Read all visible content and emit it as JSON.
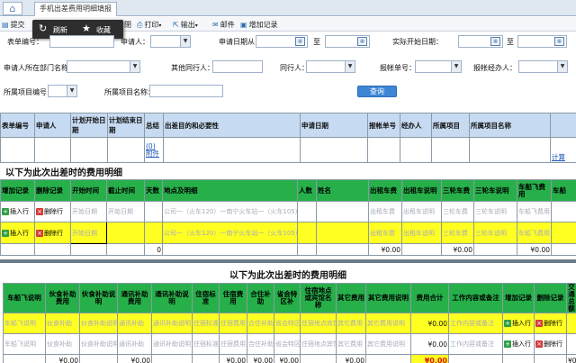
{
  "tab_title": "手机出差费用明细填报",
  "toolbar": {
    "submit": "提交",
    "print": "打印",
    "export": "输出",
    "mail": "邮件",
    "add_record": "增加记录",
    "frag": "閉"
  },
  "popup": {
    "refresh": "刷新",
    "favorite": "收藏"
  },
  "form": {
    "form_no": "表单编号：",
    "applicant": "申请人：",
    "apply_date_from": "申请日期从",
    "to1": "至",
    "actual_start": "实际开始日期：",
    "to2": "至",
    "dept": "申请人所在部门名称：",
    "other_companion": "其他同行人：",
    "companion": "同行人：",
    "reimb_no": "报帐单号：",
    "reimb_handler": "报帐经办人：",
    "project_no": "所属项目编号：",
    "project_name": "所属项目名称：",
    "query": "查询"
  },
  "grid1": {
    "headers": [
      "表单编号",
      "申请人",
      "计划开始日期",
      "计划结束日期",
      "总结",
      "出差目的和必要性",
      "申请日期",
      "报帐单号",
      "经办人",
      "所属项目",
      "所属项目名称"
    ],
    "summary_link": "(0)附件",
    "settle_link": "计算"
  },
  "section1_title": "以下为此次出差时的费用明细",
  "grid2": {
    "headers": [
      "增加记录",
      "删除记录",
      "开始时间",
      "截止时间",
      "天数",
      "地点及明细",
      "人数",
      "姓名",
      "出租车费",
      "出租车说明",
      "三轮车费",
      "三轮车说明",
      "车船飞费用",
      "车船"
    ],
    "insert_label": "插入行",
    "delete_label": "删除行",
    "start_placeholder": "开始日期",
    "end_placeholder": "开始日期",
    "route_placeholder": "公司一（火车120）一南宁火车站一（火车105）人数",
    "taxi_placeholder": "出租车费",
    "taxi_note_placeholder": "出租车说明",
    "tricycle_placeholder": "三轮车费",
    "tricycle_note_placeholder": "三轮车说明",
    "vehicle_placeholder": "车船飞费用",
    "zero_days": "0",
    "sum_taxi": "¥0.00",
    "sum_tri": "¥0.00",
    "sum_vehicle": "¥0.00"
  },
  "section2_title": "以下为此次出差时的费用明细",
  "grid3": {
    "headers": [
      "车船飞说明",
      "伙食补助费用",
      "伙食补助说明",
      "通讯补助费用",
      "通讯补助说明",
      "住宿标准",
      "住宿费用",
      "合住补助",
      "省会特区补",
      "住宿地点或宾馆名称",
      "其它费用",
      "其它费用说明",
      "费用合计",
      "工作内容或备注",
      "增加记录",
      "删除记录",
      "交通总额"
    ],
    "row_placeholders": [
      "车船飞说明",
      "伙食补助",
      "伙食补助说明",
      "通讯补助",
      "通讯补助说明",
      "住宿标准",
      "住宿费用",
      "合住补助",
      "省会特区补",
      "住宿地点宾馆名称",
      "其它费用",
      "其它费用说明"
    ],
    "row_total": "¥0.00",
    "work_placeholder": "工作内容或备注",
    "insert_label": "插入行",
    "delete_label": "删除行",
    "traffic_total": "¥0.00",
    "sums": [
      "¥0.00",
      "¥0.00",
      "¥0.00",
      "¥0.00",
      "¥0.00",
      "¥0.00",
      "¥0.00"
    ],
    "grand_total": "¥0.00"
  },
  "colors": {
    "green_header": "#27b04a",
    "yellow_row": "#ffff22",
    "blue_header": "#c6daf1",
    "accent": "#3d86d6"
  }
}
